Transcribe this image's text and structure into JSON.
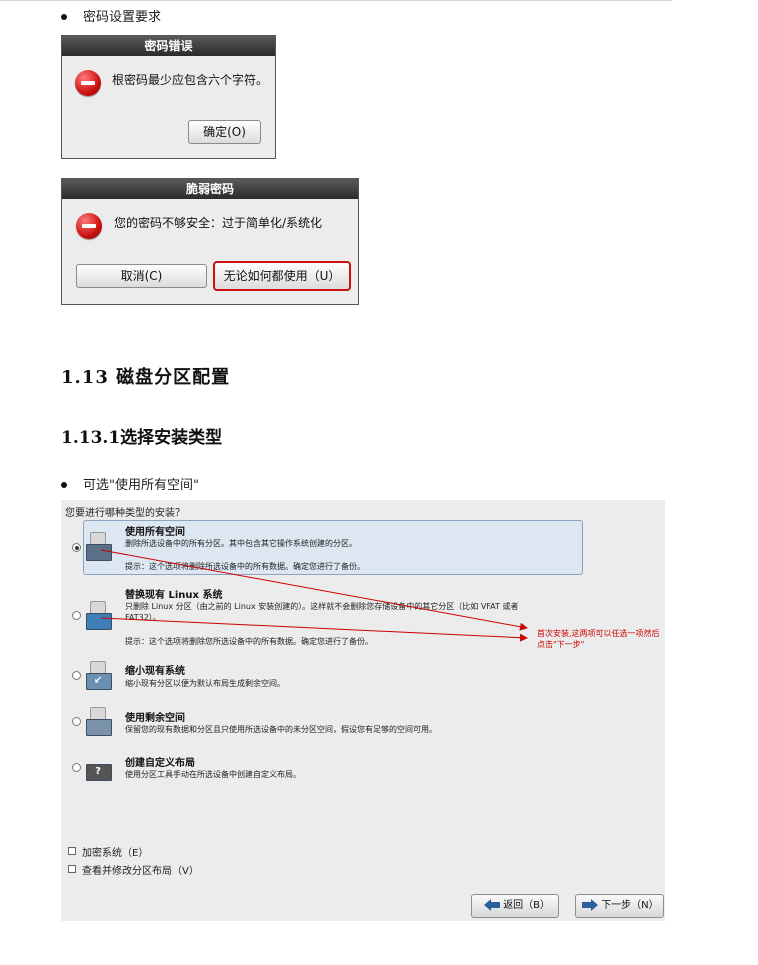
{
  "bullets": {
    "password_requirements": "密码设置要求",
    "optional_use_all": "可选\"使用所有空间\""
  },
  "dialog1": {
    "title": "密码错误",
    "message": "根密码最少应包含六个字符。",
    "ok_button": "确定(O)"
  },
  "dialog2": {
    "title": "脆弱密码",
    "message": "您的密码不够安全：过于简单化/系统化",
    "cancel_button": "取消(C)",
    "use_anyway_button": "无论如何都使用（U）",
    "highlight_color": "#cc1111"
  },
  "headings": {
    "h2_number": "1.13",
    "h2_text": "磁盘分区配置",
    "h3_number": "1.13.1",
    "h3_text": "选择安装类型"
  },
  "installer": {
    "question": "您要进行哪种类型的安装？",
    "selected_option": 0,
    "options": [
      {
        "icon": "disk-fill-icon",
        "title": "使用所有空间",
        "desc": "删除所选设备中的所有分区。其中包含其它操作系统创建的分区。",
        "hint": "提示：这个选项将删除所选设备中的所有数据。确定您进行了备份。"
      },
      {
        "icon": "disk-replace-icon",
        "title": "替换现有 Linux 系统",
        "desc": "只删除 Linux 分区（由之前的 Linux 安装创建的）。这样就不会删除您存储设备中的其它分区（比如 VFAT 或者 FAT32）。",
        "hint": "提示：这个选项将删除您所选设备中的所有数据。确定您进行了备份。"
      },
      {
        "icon": "disk-shrink-icon",
        "title": "缩小现有系统",
        "desc": "缩小现有分区以便为默认布局生成剩余空间。",
        "hint": ""
      },
      {
        "icon": "disk-free-icon",
        "title": "使用剩余空间",
        "desc": "保留您的现有数据和分区且只使用所选设备中的未分区空间，假设您有足够的空间可用。",
        "hint": ""
      },
      {
        "icon": "disk-custom-icon",
        "title": "创建自定义布局",
        "desc": "使用分区工具手动在所选设备中创建自定义布局。",
        "hint": ""
      }
    ],
    "checkbox_encrypt": "加密系统（E）",
    "checkbox_review": "查看并修改分区布局（V）",
    "back_button": "返回（B）",
    "next_button": "下一步（N）",
    "annotation": "首次安装,这两项可以任选一项然后点击\"下一步\"",
    "annotation_color": "#cc0000"
  }
}
